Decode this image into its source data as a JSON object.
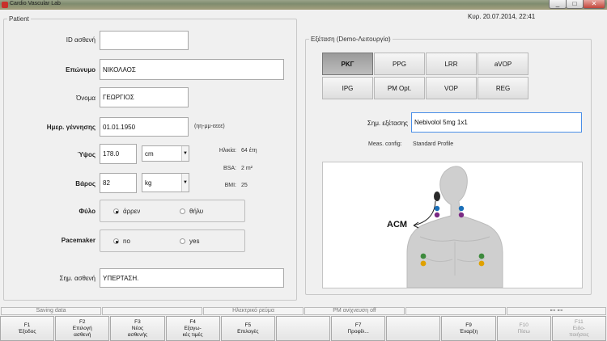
{
  "window": {
    "title": "Cardio Vascular Lab",
    "minimize": "_",
    "maximize": "□",
    "close": "✕"
  },
  "datetime": "Κυρ.  20.07.2014,  22:41",
  "patient": {
    "legend": "Patient",
    "id_label": "ID ασθενή",
    "id_value": "",
    "surname_label": "Επώνυμο",
    "surname_value": "ΝΙΚΟΛΑΟΣ",
    "name_label": "Όνομα",
    "name_value": "ΓΕΩΡΓΙΟΣ",
    "dob_label": "Ημερ. γέννησης",
    "dob_value": "01.01.1950",
    "dob_hint": "(ηη-μμ-εεεε)",
    "height_label": "Ύψος",
    "height_value": "178.0",
    "height_unit": "cm",
    "weight_label": "Βάρος",
    "weight_value": "82",
    "weight_unit": "kg",
    "age_label": "Ηλικία:",
    "age_value": "64 έτη",
    "bsa_label": "BSA:",
    "bsa_value": "2 m²",
    "bmi_label": "BMI:",
    "bmi_value": "25",
    "sex_label": "Φύλο",
    "sex_options": [
      "άρρεν",
      "θήλυ"
    ],
    "sex_selected": "άρρεν",
    "pacemaker_label": "Pacemaker",
    "pacemaker_options": [
      "no",
      "yes"
    ],
    "pacemaker_selected": "no",
    "note_label": "Σημ. ασθενή",
    "note_value": "ΥΠΕΡΤΑΣΗ."
  },
  "exam": {
    "legend": "Εξέταση (Demo-Λειτουργία)",
    "buttons": [
      "ΡΚΓ",
      "PPG",
      "LRR",
      "aVOP",
      "IPG",
      "PM Opt.",
      "VOP",
      "REG"
    ],
    "active": "ΡΚΓ",
    "note_label": "Σημ. εξέτασης",
    "note_value": "Nebivolol 5mg 1x1",
    "config_label": "Meas. config:",
    "config_value": "Standard Profile",
    "acm_label": "ACM"
  },
  "status": {
    "saving": "Saving data",
    "power": "Ηλεκτρικό ρεύμα",
    "pm": "PM ανίχνευση off",
    "icons": "⊷ ⊷"
  },
  "fkeys": [
    {
      "key": "F1",
      "label": "Έξοδος",
      "enabled": true
    },
    {
      "key": "F2",
      "label": "Επιλογή\nασθενή",
      "enabled": true
    },
    {
      "key": "F3",
      "label": "Νέος\nασθενής",
      "enabled": true
    },
    {
      "key": "F4",
      "label": "Εξαγω-\nκές τιμές",
      "enabled": true
    },
    {
      "key": "F5",
      "label": "Επιλογές",
      "enabled": true
    },
    {
      "key": "",
      "label": "",
      "enabled": true
    },
    {
      "key": "F7",
      "label": "Προφίλ...",
      "enabled": true
    },
    {
      "key": "",
      "label": "",
      "enabled": true
    },
    {
      "key": "F9",
      "label": "Έναρξη",
      "enabled": true
    },
    {
      "key": "F10",
      "label": "Πίσω",
      "enabled": false
    },
    {
      "key": "F11",
      "label": "Ειδο-\nποιήσεις",
      "enabled": false
    }
  ]
}
